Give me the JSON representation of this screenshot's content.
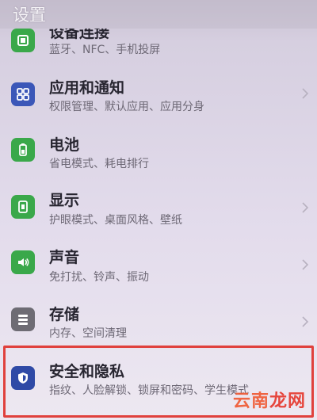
{
  "header": {
    "title": "设置"
  },
  "items": [
    {
      "label": "设备连接",
      "desc": "蓝牙、NFC、手机投屏",
      "icon": "link-icon",
      "color": "#3aa84a"
    },
    {
      "label": "应用和通知",
      "desc": "权限管理、默认应用、应用分身",
      "icon": "grid-apps-icon",
      "color": "#3b57b8"
    },
    {
      "label": "电池",
      "desc": "省电模式、耗电排行",
      "icon": "battery-icon",
      "color": "#3aa84a"
    },
    {
      "label": "显示",
      "desc": "护眼模式、桌面风格、壁纸",
      "icon": "display-icon",
      "color": "#3aa84a"
    },
    {
      "label": "声音",
      "desc": "免打扰、铃声、振动",
      "icon": "speaker-icon",
      "color": "#3aa84a"
    },
    {
      "label": "存储",
      "desc": "内存、空间清理",
      "icon": "storage-icon",
      "color": "#6e6c74"
    },
    {
      "label": "安全和隐私",
      "desc": "指纹、人脸解锁、锁屏和密码、学生模式",
      "icon": "shield-icon",
      "color": "#2f4aa6"
    }
  ],
  "watermark": {
    "text1": "云南",
    "text2": "龙网"
  },
  "highlight_color": "#e0413d"
}
